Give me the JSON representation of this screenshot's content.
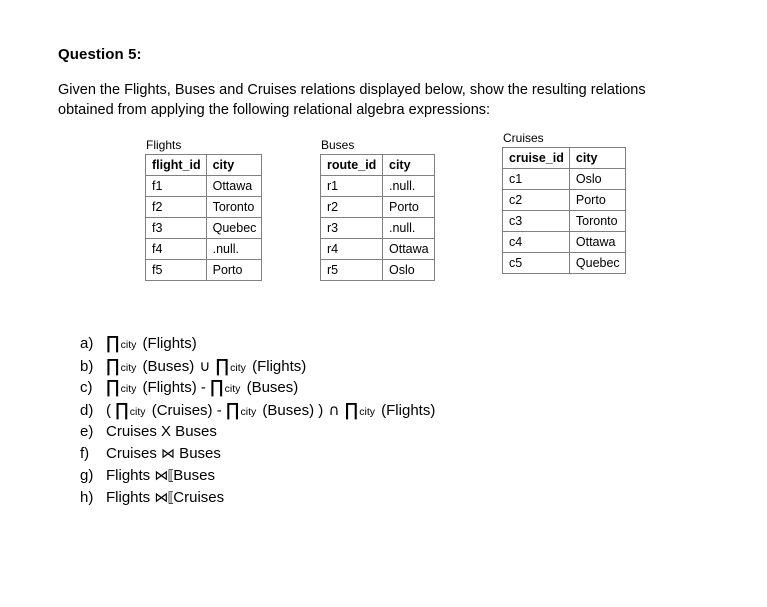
{
  "document": {
    "title": "Question 5:",
    "intro": "Given the Flights, Buses and Cruises relations obtained from applying the following relational algebra expressions:",
    "intro_line1": "Given the Flights, Buses and Cruises relations displayed below, show the resulting",
    "intro_line2": "relations obtained from applying the following relational algebra expressions:"
  },
  "relations": [
    {
      "name": "Flights",
      "caption": "Flights",
      "columns": [
        "flight_id",
        "city"
      ],
      "rows": [
        [
          "f1",
          "Ottawa"
        ],
        [
          "f2",
          "Toronto"
        ],
        [
          "f3",
          "Quebec"
        ],
        [
          "f4",
          ".null."
        ],
        [
          "f5",
          "Porto"
        ]
      ]
    },
    {
      "name": "Buses",
      "caption": "Buses",
      "columns": [
        "route_id",
        "city"
      ],
      "rows": [
        [
          "r1",
          ".null."
        ],
        [
          "r2",
          "Porto"
        ],
        [
          "r3",
          ".null."
        ],
        [
          "r4",
          "Ottawa"
        ],
        [
          "r5",
          "Oslo"
        ]
      ]
    },
    {
      "name": "Cruises",
      "caption": "Cruises",
      "columns": [
        "cruise_id",
        "city"
      ],
      "rows": [
        [
          "c1",
          "Oslo"
        ],
        [
          "c2",
          "Porto"
        ],
        [
          "c3",
          "Toronto"
        ],
        [
          "c4",
          "Ottawa"
        ],
        [
          "c5",
          "Quebec"
        ]
      ]
    }
  ],
  "expressions": [
    {
      "label": "a)",
      "text": "∏ city (Flights)",
      "parts": [
        {
          "t": "pi",
          "v": "∏"
        },
        {
          "t": "sub",
          "v": "city"
        },
        {
          "t": "txt",
          "v": " (Flights)"
        }
      ]
    },
    {
      "label": "b)",
      "text": "∏ city (Buses) ∪ ∏ city (Flights)",
      "parts": [
        {
          "t": "pi",
          "v": "∏"
        },
        {
          "t": "sub",
          "v": "city"
        },
        {
          "t": "txt",
          "v": " (Buses) "
        },
        {
          "t": "op",
          "v": "∪"
        },
        {
          "t": "txt",
          "v": " "
        },
        {
          "t": "pi",
          "v": "∏"
        },
        {
          "t": "sub",
          "v": "city"
        },
        {
          "t": "txt",
          "v": " (Flights)"
        }
      ]
    },
    {
      "label": "c)",
      "text": "∏ city (Flights) - ∏ city (Buses)",
      "parts": [
        {
          "t": "pi",
          "v": "∏"
        },
        {
          "t": "sub",
          "v": "city"
        },
        {
          "t": "txt",
          "v": " (Flights) - "
        },
        {
          "t": "pi",
          "v": "∏"
        },
        {
          "t": "sub",
          "v": "city"
        },
        {
          "t": "txt",
          "v": " (Buses)"
        }
      ]
    },
    {
      "label": "d)",
      "text": "( ∏ city (Cruises) - ∏ city (Buses) ) ∩ ∏ city (Flights)",
      "parts": [
        {
          "t": "txt",
          "v": "( "
        },
        {
          "t": "pi",
          "v": "∏"
        },
        {
          "t": "sub",
          "v": "city"
        },
        {
          "t": "txt",
          "v": " (Cruises) - "
        },
        {
          "t": "pi",
          "v": "∏"
        },
        {
          "t": "sub",
          "v": "city"
        },
        {
          "t": "txt",
          "v": " (Buses) ) "
        },
        {
          "t": "op",
          "v": "∩"
        },
        {
          "t": "txt",
          "v": " "
        },
        {
          "t": "pi",
          "v": "∏"
        },
        {
          "t": "sub",
          "v": "city"
        },
        {
          "t": "txt",
          "v": " (Flights)"
        }
      ]
    },
    {
      "label": "e)",
      "text": "Cruises X Buses",
      "parts": [
        {
          "t": "txt",
          "v": "Cruises X Buses"
        }
      ]
    },
    {
      "label": "f)",
      "text": "Cruises ⋈ Buses",
      "parts": [
        {
          "t": "txt",
          "v": "Cruises "
        },
        {
          "t": "join",
          "v": "⋈"
        },
        {
          "t": "txt",
          "v": " Buses"
        }
      ]
    },
    {
      "label": "g)",
      "text": "Flights ⟖Buses",
      "parts": [
        {
          "t": "txt",
          "v": "Flights "
        },
        {
          "t": "ojoin",
          "v": "⋈⟦"
        },
        {
          "t": "txt",
          "v": "Buses"
        }
      ]
    },
    {
      "label": "h)",
      "text": "Flights ⟖Cruises",
      "parts": [
        {
          "t": "txt",
          "v": "Flights "
        },
        {
          "t": "ojoin",
          "v": "⋈⟦"
        },
        {
          "t": "txt",
          "v": "Cruises"
        }
      ]
    }
  ]
}
